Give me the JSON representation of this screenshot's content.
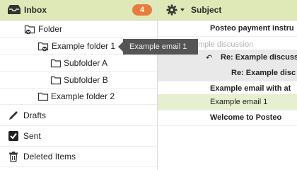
{
  "sidebar": {
    "inbox": {
      "label": "Inbox",
      "count": "4",
      "icon": "inbox-icon"
    },
    "folders": [
      {
        "label": "Folder"
      },
      {
        "label": "Example folder 1"
      },
      {
        "label": "Subfolder A"
      },
      {
        "label": "Subfolder B"
      },
      {
        "label": "Example folder 2"
      }
    ],
    "mailboxes": [
      {
        "label": "Drafts",
        "icon": "pencil-icon"
      },
      {
        "label": "Sent",
        "icon": "checkbox-icon"
      },
      {
        "label": "Deleted Items",
        "icon": "trash-icon"
      }
    ]
  },
  "tooltip": {
    "text": "Example email 1"
  },
  "message_list": {
    "header": {
      "column_label": "Subject",
      "icon": "gear-icon"
    },
    "messages": [
      {
        "subject": "Posteo payment instru"
      },
      {
        "subject": "Example discussion"
      },
      {
        "subject": "Re: Example discuss"
      },
      {
        "subject": "Re: Example disc"
      },
      {
        "subject": "Example email with at"
      },
      {
        "subject": "Example email 1"
      },
      {
        "subject": "Welcome to Posteo"
      }
    ]
  },
  "colors": {
    "header_bg": "#dfe9b8",
    "badge": "#e87c3e",
    "selected_row": "#e6efcf",
    "tooltip_bg": "#555555"
  }
}
